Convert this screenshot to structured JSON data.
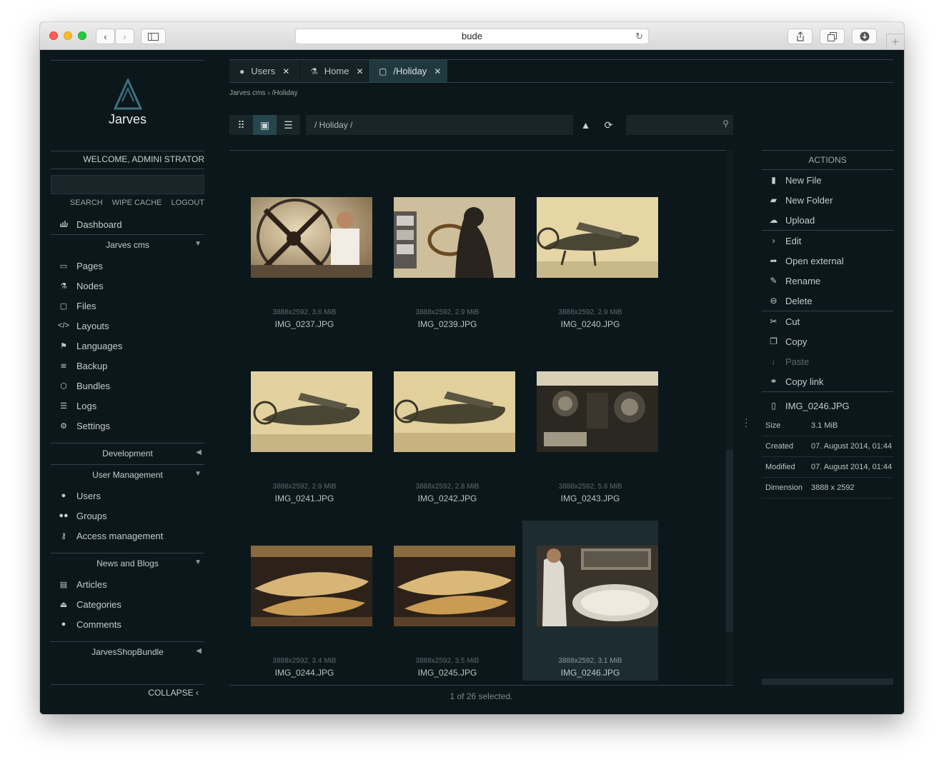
{
  "browser": {
    "url": "bude"
  },
  "sidebar": {
    "logo_text": "Jarves",
    "welcome": "WELCOME, ADMINI STRATOR",
    "links": [
      "SEARCH",
      "WIPE CACHE",
      "LOGOUT"
    ],
    "dashboard": "Dashboard",
    "sections": [
      {
        "label": "Jarves cms",
        "items": [
          "Pages",
          "Nodes",
          "Files",
          "Layouts",
          "Languages",
          "Backup",
          "Bundles",
          "Logs",
          "Settings"
        ]
      },
      {
        "label": "Development"
      },
      {
        "label": "User Management",
        "items": [
          "Users",
          "Groups",
          "Access management"
        ]
      },
      {
        "label": "News and Blogs",
        "items": [
          "Articles",
          "Categories",
          "Comments"
        ]
      },
      {
        "label": "JarvesShopBundle"
      }
    ],
    "collapse": "COLLAPSE"
  },
  "tabs": [
    {
      "label": "Users",
      "icon": "user-icon",
      "active": false
    },
    {
      "label": "Home",
      "icon": "sitemap-icon",
      "active": false
    },
    {
      "label": "/Holiday",
      "icon": "folder-icon",
      "active": true
    }
  ],
  "breadcrumb": {
    "root": "Jarves cms",
    "sep": "›",
    "current": "/Holiday"
  },
  "path": "/ Holiday /",
  "files": [
    {
      "meta": "3888x2592, 3.6 MiB",
      "name": "IMG_0237.JPG"
    },
    {
      "meta": "3888x2592, 2.9 MiB",
      "name": "IMG_0239.JPG"
    },
    {
      "meta": "3888x2592, 2.9 MiB",
      "name": "IMG_0240.JPG"
    },
    {
      "meta": "3888x2592, 2.9 MiB",
      "name": "IMG_0241.JPG"
    },
    {
      "meta": "3888x2592, 2.8 MiB",
      "name": "IMG_0242.JPG"
    },
    {
      "meta": "3888x2592, 5.6 MiB",
      "name": "IMG_0243.JPG"
    },
    {
      "meta": "3888x2592, 3.4 MiB",
      "name": "IMG_0244.JPG"
    },
    {
      "meta": "3888x2592, 3.5 MiB",
      "name": "IMG_0245.JPG"
    },
    {
      "meta": "3888x2592, 3.1 MiB",
      "name": "IMG_0246.JPG",
      "selected": true
    }
  ],
  "status": "1 of 26 selected.",
  "actions": {
    "title": "ACTIONS",
    "items": [
      {
        "label": "New File",
        "icon": "new-file-icon"
      },
      {
        "label": "New Folder",
        "icon": "new-folder-icon"
      },
      {
        "label": "Upload",
        "icon": "upload-icon"
      },
      {
        "label": "Edit",
        "icon": "chevron-right-icon"
      },
      {
        "label": "Open external",
        "icon": "share-icon"
      },
      {
        "label": "Rename",
        "icon": "pencil-icon"
      },
      {
        "label": "Delete",
        "icon": "minus-circle-icon"
      },
      {
        "label": "Cut",
        "icon": "scissors-icon"
      },
      {
        "label": "Copy",
        "icon": "copy-icon"
      },
      {
        "label": "Paste",
        "icon": "paste-icon",
        "disabled": true
      },
      {
        "label": "Copy link",
        "icon": "link-icon"
      }
    ]
  },
  "details": {
    "filename": "IMG_0246.JPG",
    "props": [
      {
        "key": "Size",
        "value": "3.1 MiB"
      },
      {
        "key": "Created",
        "value": "07. August 2014, 01:44"
      },
      {
        "key": "Modified",
        "value": "07. August 2014, 01:44"
      },
      {
        "key": "Dimension",
        "value": "3888 x 2592"
      }
    ]
  }
}
